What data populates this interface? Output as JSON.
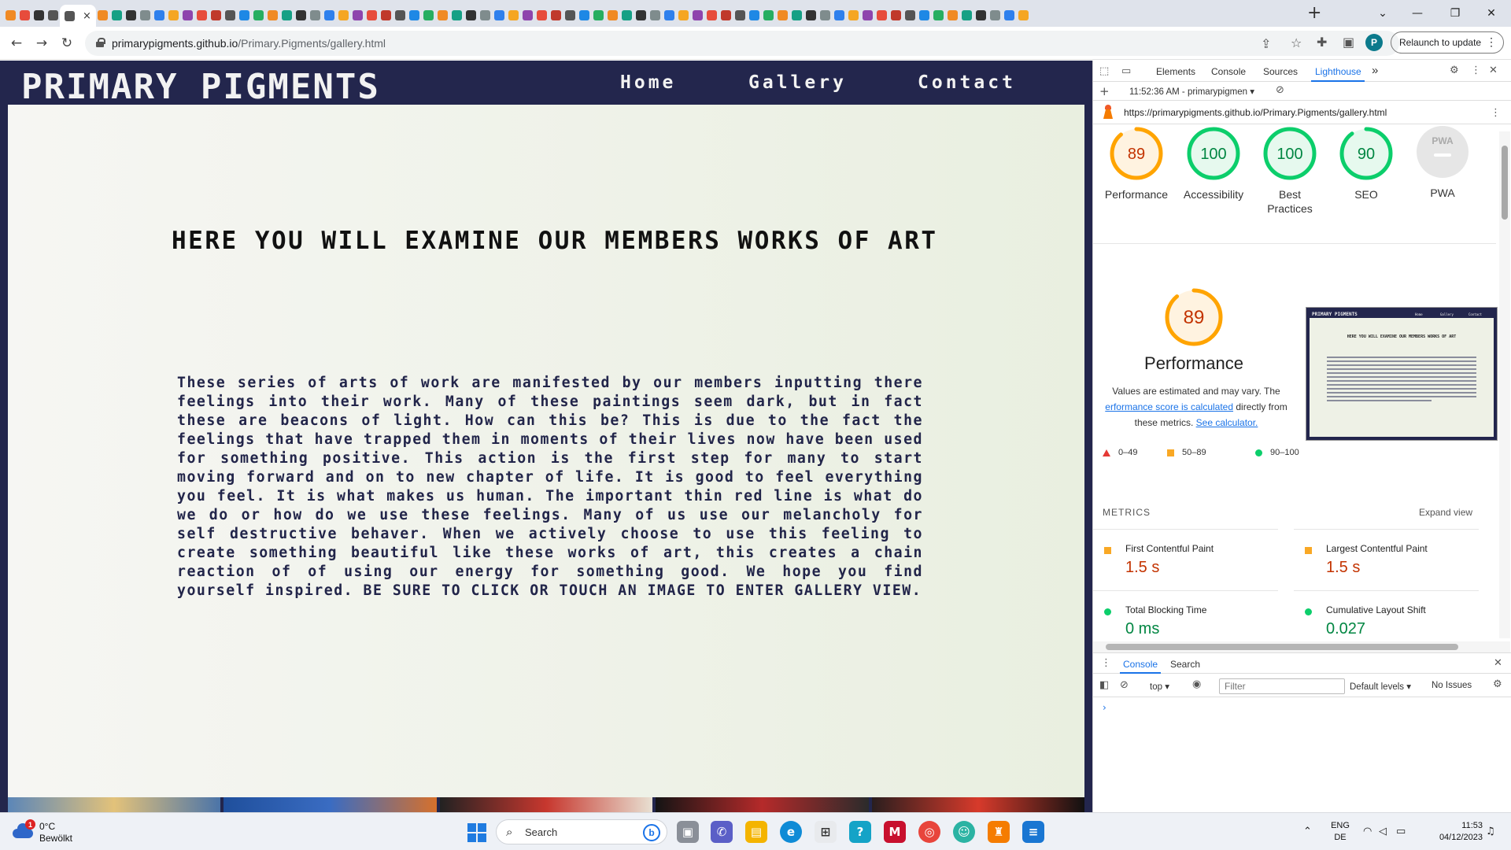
{
  "browser": {
    "active_tab_close": "×",
    "new_tab": "+",
    "url_host": "primarypigments.github.io",
    "url_path": "/Primary.Pigments/gallery.html",
    "relaunch_label": "Relaunch to update",
    "profile_initial": "P",
    "window_controls": {
      "minimize": "⌄",
      "min": "—",
      "restore": "❐",
      "close": "✕"
    }
  },
  "site": {
    "logo": "PRIMARY PIGMENTS",
    "nav": {
      "home": "Home",
      "gallery": "Gallery",
      "contact": "Contact"
    },
    "heading": "HERE YOU WILL EXAMINE OUR MEMBERS WORKS OF ART",
    "paragraph": "These series of arts of work are manifested by our members inputting there feelings into their work. Many of these paintings seem dark, but in fact these are beacons of light. How can this be? This is due to the fact the feelings that have trapped them in moments of their lives now have been used for something positive. This action is the first step for many to start moving forward and on to new chapter of life. It is good to feel everything you feel. It is what makes us human. The important thin red line is what do we do or how do we use these feelings. Many of us use our melancholy for self destructive behaver. When we actively choose to use this feeling to create something beautiful like these works of art, this creates a chain reaction of of using our energy for something good. We hope you find yourself inspired. BE SURE TO CLICK OR TOUCH AN IMAGE TO ENTER GALLERY VIEW."
  },
  "devtools": {
    "tabs": {
      "elements": "Elements",
      "console": "Console",
      "sources": "Sources",
      "lighthouse": "Lighthouse",
      "more": "»"
    },
    "report_selector": "11:52:36 AM - primarypigmen",
    "report_url": "https://primarypigments.github.io/Primary.Pigments/gallery.html",
    "scores": [
      {
        "label": "Performance",
        "value": "89",
        "score": 89,
        "color": "#ffa400",
        "bg": "#fff3e0",
        "text": "#c33300"
      },
      {
        "label": "Accessibility",
        "value": "100",
        "score": 100,
        "color": "#0cce6b",
        "bg": "#e6f9ee",
        "text": "#018642"
      },
      {
        "label": "Best Practices",
        "value": "100",
        "score": 100,
        "color": "#0cce6b",
        "bg": "#e6f9ee",
        "text": "#018642"
      },
      {
        "label": "SEO",
        "value": "90",
        "score": 90,
        "color": "#0cce6b",
        "bg": "#e6f9ee",
        "text": "#018642"
      }
    ],
    "pwa": {
      "label": "PWA",
      "badge_text": "PWA"
    },
    "performance": {
      "score": "89",
      "title": "Performance",
      "note_line1": "Values are estimated and may vary. The",
      "note_link1": "erformance score is calculated",
      "note_line2": " directly from these metrics. ",
      "note_link2": "See calculator."
    },
    "screenshot": {
      "logo": "PRIMARY PIGMENTS",
      "nav_home": "Home",
      "nav_gallery": "Gallery",
      "nav_contact": "Contact",
      "heading": "HERE YOU WILL EXAMINE OUR MEMBERS WORKS OF ART"
    },
    "legend": {
      "fail": "0–49",
      "average": "50–89",
      "pass": "90–100"
    },
    "metrics_header": "METRICS",
    "expand_view": "Expand view",
    "metrics": [
      {
        "name": "First Contentful Paint",
        "value": "1.5 s",
        "status": "average"
      },
      {
        "name": "Largest Contentful Paint",
        "value": "1.5 s",
        "status": "average"
      },
      {
        "name": "Total Blocking Time",
        "value": "0 ms",
        "status": "pass"
      },
      {
        "name": "Cumulative Layout Shift",
        "value": "0.027",
        "status": "pass"
      }
    ],
    "drawer": {
      "tab_console": "Console",
      "tab_search": "Search",
      "context": "top",
      "filter_placeholder": "Filter",
      "levels": "Default levels",
      "issues": "No Issues",
      "prompt": "›"
    }
  },
  "taskbar": {
    "weather_temp": "0°C",
    "weather_desc": "Bewölkt",
    "weather_badge": "1",
    "search_label": "Search",
    "lang_line1": "ENG",
    "lang_line2": "DE",
    "time": "11:53",
    "date": "04/12/2023"
  }
}
